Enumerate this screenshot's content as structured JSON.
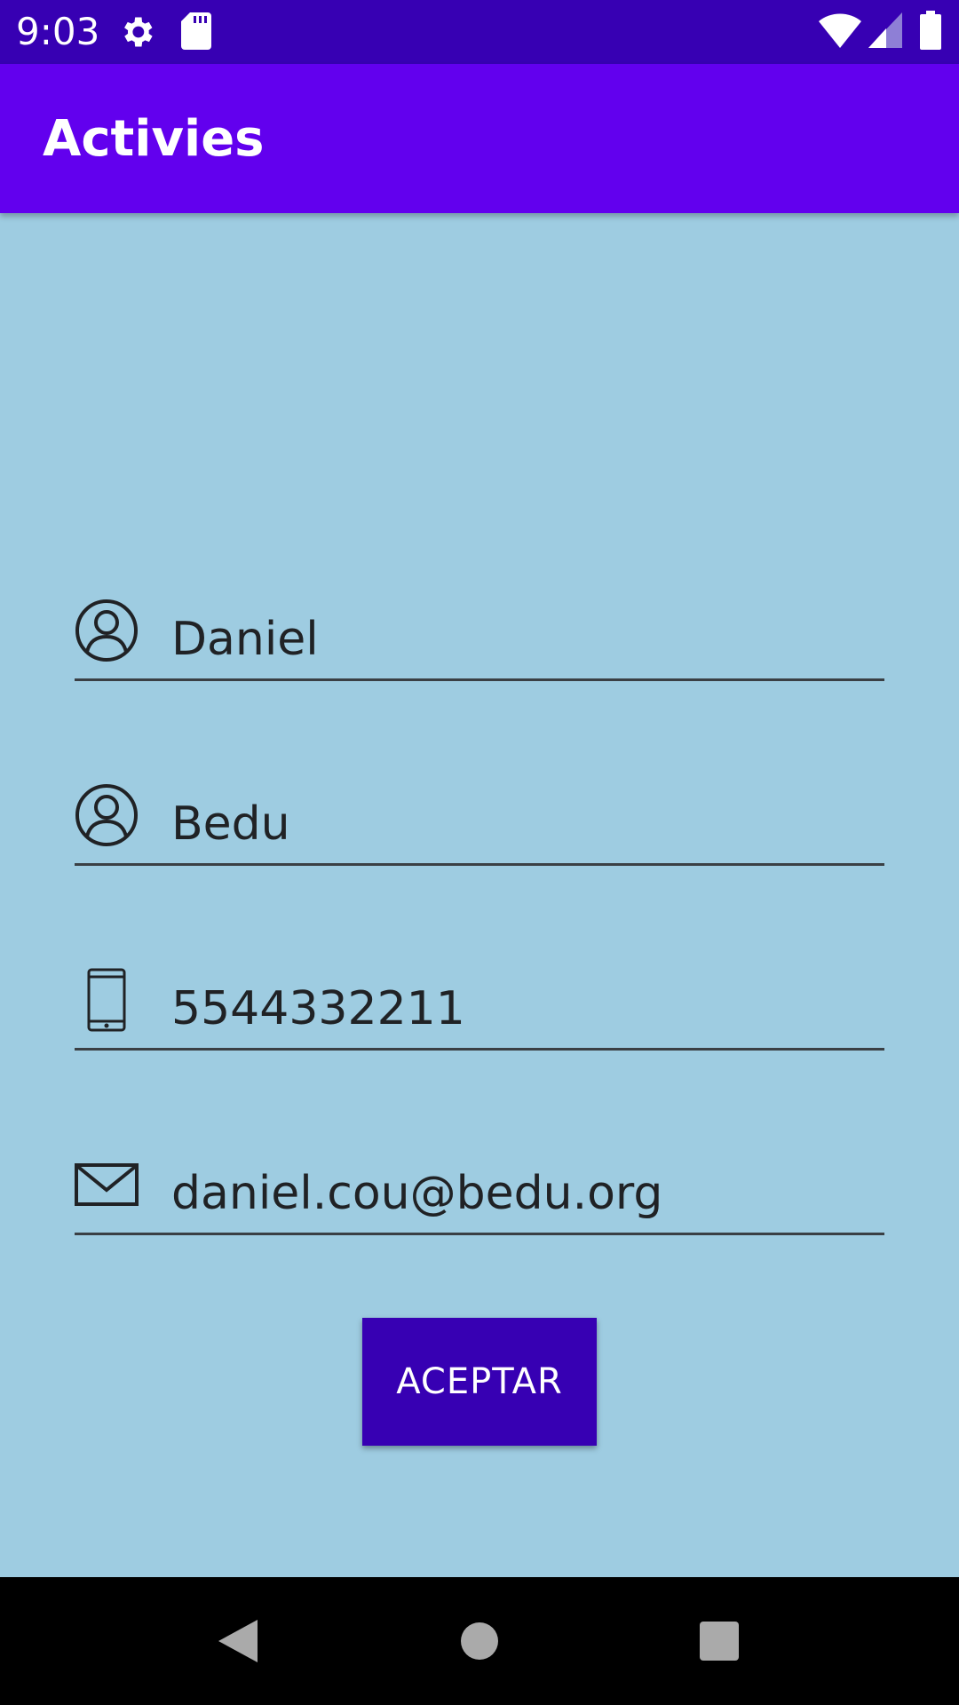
{
  "status_bar": {
    "time": "9:03",
    "icons": [
      "settings-icon",
      "sd-card-icon",
      "wifi-icon",
      "signal-icon",
      "battery-icon"
    ]
  },
  "app_bar": {
    "title": "Activies"
  },
  "form": {
    "fields": [
      {
        "name": "first-name",
        "icon": "person-icon",
        "value": "Daniel"
      },
      {
        "name": "last-name",
        "icon": "person-icon",
        "value": "Bedu"
      },
      {
        "name": "phone",
        "icon": "phone-icon",
        "value": "5544332211"
      },
      {
        "name": "email",
        "icon": "mail-icon",
        "value": "daniel.cou@bedu.org"
      }
    ],
    "submit_label": "ACEPTAR"
  },
  "nav_bar": {
    "buttons": [
      "back-icon",
      "home-icon",
      "recents-icon"
    ]
  },
  "colors": {
    "status_bar": "#3700b3",
    "app_bar": "#6200ee",
    "background": "#9ecce1",
    "button": "#3700b3"
  }
}
